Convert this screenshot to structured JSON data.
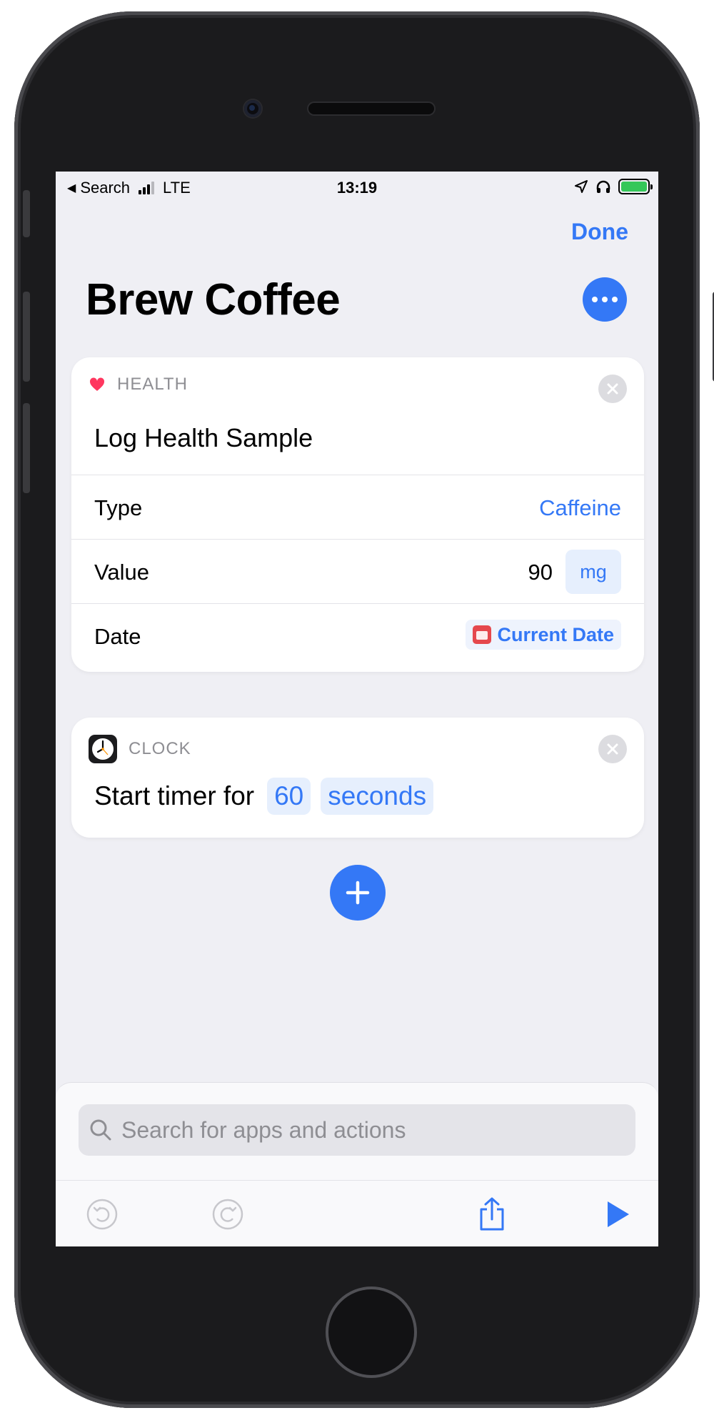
{
  "status_bar": {
    "back_label": "Search",
    "carrier": "LTE",
    "time": "13:19",
    "battery_state": "charging"
  },
  "nav": {
    "done_label": "Done"
  },
  "shortcut": {
    "title": "Brew Coffee"
  },
  "actions": [
    {
      "app": "HEALTH",
      "app_icon": "heart-icon",
      "title": "Log Health Sample",
      "rows": [
        {
          "label": "Type",
          "value": "Caffeine"
        },
        {
          "label": "Value",
          "value": "90",
          "unit": "mg"
        },
        {
          "label": "Date",
          "value": "Current Date",
          "icon": "calendar-icon"
        }
      ]
    },
    {
      "app": "CLOCK",
      "app_icon": "clock-icon",
      "sentence": "Start timer for",
      "duration": "60",
      "duration_unit": "seconds"
    }
  ],
  "search": {
    "placeholder": "Search for apps and actions",
    "value": ""
  },
  "colors": {
    "accent": "#3478f6",
    "background": "#efeff4",
    "health_red": "#ff375f",
    "calendar_red": "#e5484d"
  }
}
